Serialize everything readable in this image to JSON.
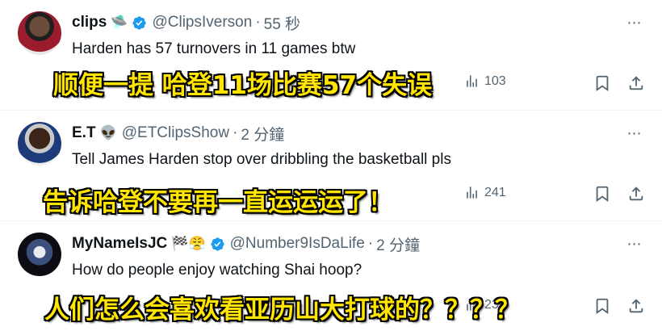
{
  "tweets": [
    {
      "name": "clips",
      "emoji": "🛸",
      "handle": "@ClipsIverson",
      "time": "55 秒",
      "text": "Harden has 57 turnovers in 11 games btw",
      "overlay": "顺便一提 哈登11场比赛57个失误",
      "views": "103",
      "icons": [
        "avatar",
        "ufo-emoji",
        "verified-badge-icon",
        "more-icon",
        "views-icon",
        "bookmark-icon",
        "share-icon"
      ]
    },
    {
      "name": "E.T",
      "emoji": "👽",
      "handle": "@ETClipsShow",
      "time": "2 分鐘",
      "text": "Tell James Harden stop over dribbling the basketball pls",
      "overlay": "告诉哈登不要再一直运运运了！",
      "views": "241",
      "icons": [
        "avatar",
        "alien-emoji",
        "more-icon",
        "views-icon",
        "bookmark-icon",
        "share-icon"
      ]
    },
    {
      "name": "MyNameIsJC",
      "emoji": "🏁😤",
      "handle": "@Number9IsDaLife",
      "time": "2 分鐘",
      "text": "How do people enjoy watching Shai hoop?",
      "overlay": "人们怎么会喜欢看亚历山大打球的？？？？",
      "views": "239",
      "icons": [
        "avatar",
        "checkered-flag-emoji",
        "steam-face-emoji",
        "verified-badge-icon",
        "more-icon",
        "views-icon",
        "bookmark-icon",
        "share-icon"
      ]
    }
  ],
  "colors": {
    "text": "#0f1419",
    "muted": "#536471",
    "verified": "#1d9bf0",
    "caption_fill": "#ffe500",
    "divider": "#eff3f4"
  },
  "separator": "·",
  "more_glyph": "⋯"
}
